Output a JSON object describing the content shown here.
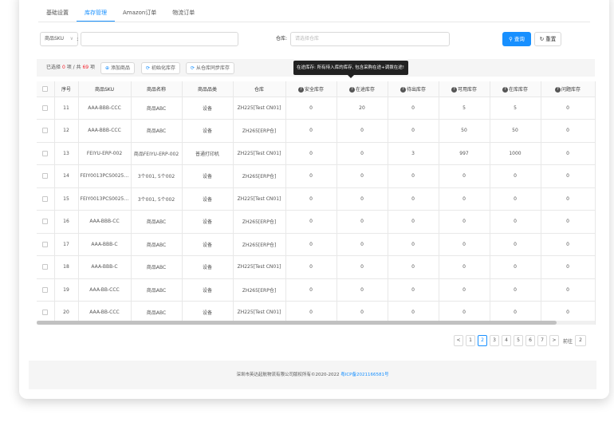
{
  "tabs": [
    {
      "label": "基础设置"
    },
    {
      "label": "库存管理",
      "active": true
    },
    {
      "label": "Amazon订单"
    },
    {
      "label": "物流订单"
    }
  ],
  "filter": {
    "sku_select": "商品SKU",
    "colon": ":",
    "warehouse_label": "仓库:",
    "warehouse_placeholder": "请选择仓库",
    "query_btn": "查询",
    "reset_btn": "重置"
  },
  "toolbar": {
    "selected_prefix": "已选择",
    "selected_count": "0",
    "selected_mid": "项 / 共",
    "total_count": "69",
    "selected_suffix": "项",
    "add_btn": "添加商品",
    "init_btn": "初始化库存",
    "sync_btn": "从仓库同步库存"
  },
  "tooltip": "在途库存: 所有待入库的库存, 包含采购在途+调拨在途!",
  "columns": [
    "",
    "序号",
    "商品SKU",
    "商品名称",
    "商品品类",
    "仓库",
    "安全库存",
    "在途库存",
    "待出库存",
    "可用库存",
    "在库库存",
    "问题库存"
  ],
  "rows": [
    [
      "11",
      "AAA-BBB-CCC",
      "商品ABC",
      "设备",
      "ZH225[Test CN01]",
      "0",
      "20",
      "0",
      "5",
      "5",
      "0"
    ],
    [
      "12",
      "AAA-BBB-CCC",
      "商品ABC",
      "设备",
      "ZH265[ERP仓]",
      "0",
      "0",
      "0",
      "50",
      "50",
      "0"
    ],
    [
      "13",
      "FEIYU-ERP-002",
      "商品FEIYU-ERP-002",
      "普通打印机",
      "ZH225[Test CN01]",
      "0",
      "0",
      "3",
      "997",
      "1000",
      "0"
    ],
    [
      "14",
      "FEIY0013PCS0025P...",
      "3个001, 5个002",
      "设备",
      "ZH265[ERP仓]",
      "0",
      "0",
      "0",
      "0",
      "0",
      "0"
    ],
    [
      "15",
      "FEIY0013PCS0025P...",
      "3个001, 5个002",
      "设备",
      "ZH225[Test CN01]",
      "0",
      "0",
      "0",
      "0",
      "0",
      "0"
    ],
    [
      "16",
      "AAA-BBB-CC",
      "商品ABC",
      "设备",
      "ZH265[ERP仓]",
      "0",
      "0",
      "0",
      "0",
      "0",
      "0"
    ],
    [
      "17",
      "AAA-BBB-C",
      "商品ABC",
      "设备",
      "ZH265[ERP仓]",
      "0",
      "0",
      "0",
      "0",
      "0",
      "0"
    ],
    [
      "18",
      "AAA-BBB-C",
      "商品ABC",
      "设备",
      "ZH225[Test CN01]",
      "0",
      "0",
      "0",
      "0",
      "0",
      "0"
    ],
    [
      "19",
      "AAA-BB-CCC",
      "商品ABC",
      "设备",
      "ZH265[ERP仓]",
      "0",
      "0",
      "0",
      "0",
      "0",
      "0"
    ],
    [
      "20",
      "AAA-BB-CCC",
      "商品ABC",
      "设备",
      "ZH225[Test CN01]",
      "0",
      "0",
      "0",
      "0",
      "0",
      "0"
    ]
  ],
  "pagination": {
    "prev": "<",
    "pages": [
      "1",
      "2",
      "3",
      "4",
      "5",
      "6",
      "7"
    ],
    "current": "2",
    "next": ">",
    "goto_label": "前往",
    "goto_value": "2"
  },
  "footer": {
    "text": "深圳市英达起航物流有限公司版权所有©2020-2022 ",
    "icp": "粤ICP备2021166581号"
  },
  "colors": {
    "accent": "#1890ff",
    "danger": "#f5222d"
  }
}
